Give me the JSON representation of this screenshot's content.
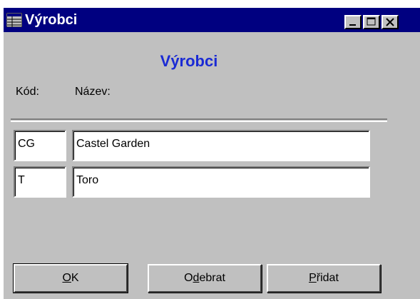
{
  "window": {
    "title": "Výrobci",
    "icon": "table-icon",
    "controls": [
      "minimize",
      "maximize",
      "close"
    ]
  },
  "form": {
    "heading": "Výrobci",
    "columns": {
      "code_label": "Kód:",
      "name_label": "Název:"
    },
    "rows": [
      {
        "code": "CG",
        "name": "Castel Garden"
      },
      {
        "code": "T",
        "name": "Toro"
      }
    ]
  },
  "buttons": {
    "ok": {
      "pre": "",
      "key": "O",
      "post": "K"
    },
    "remove": {
      "pre": "O",
      "key": "d",
      "post": "ebrat"
    },
    "add": {
      "pre": "",
      "key": "P",
      "post": "řidat"
    }
  },
  "colors": {
    "titlebar": "#000080",
    "heading": "#1a2ad4",
    "face": "#c0c0c0"
  }
}
